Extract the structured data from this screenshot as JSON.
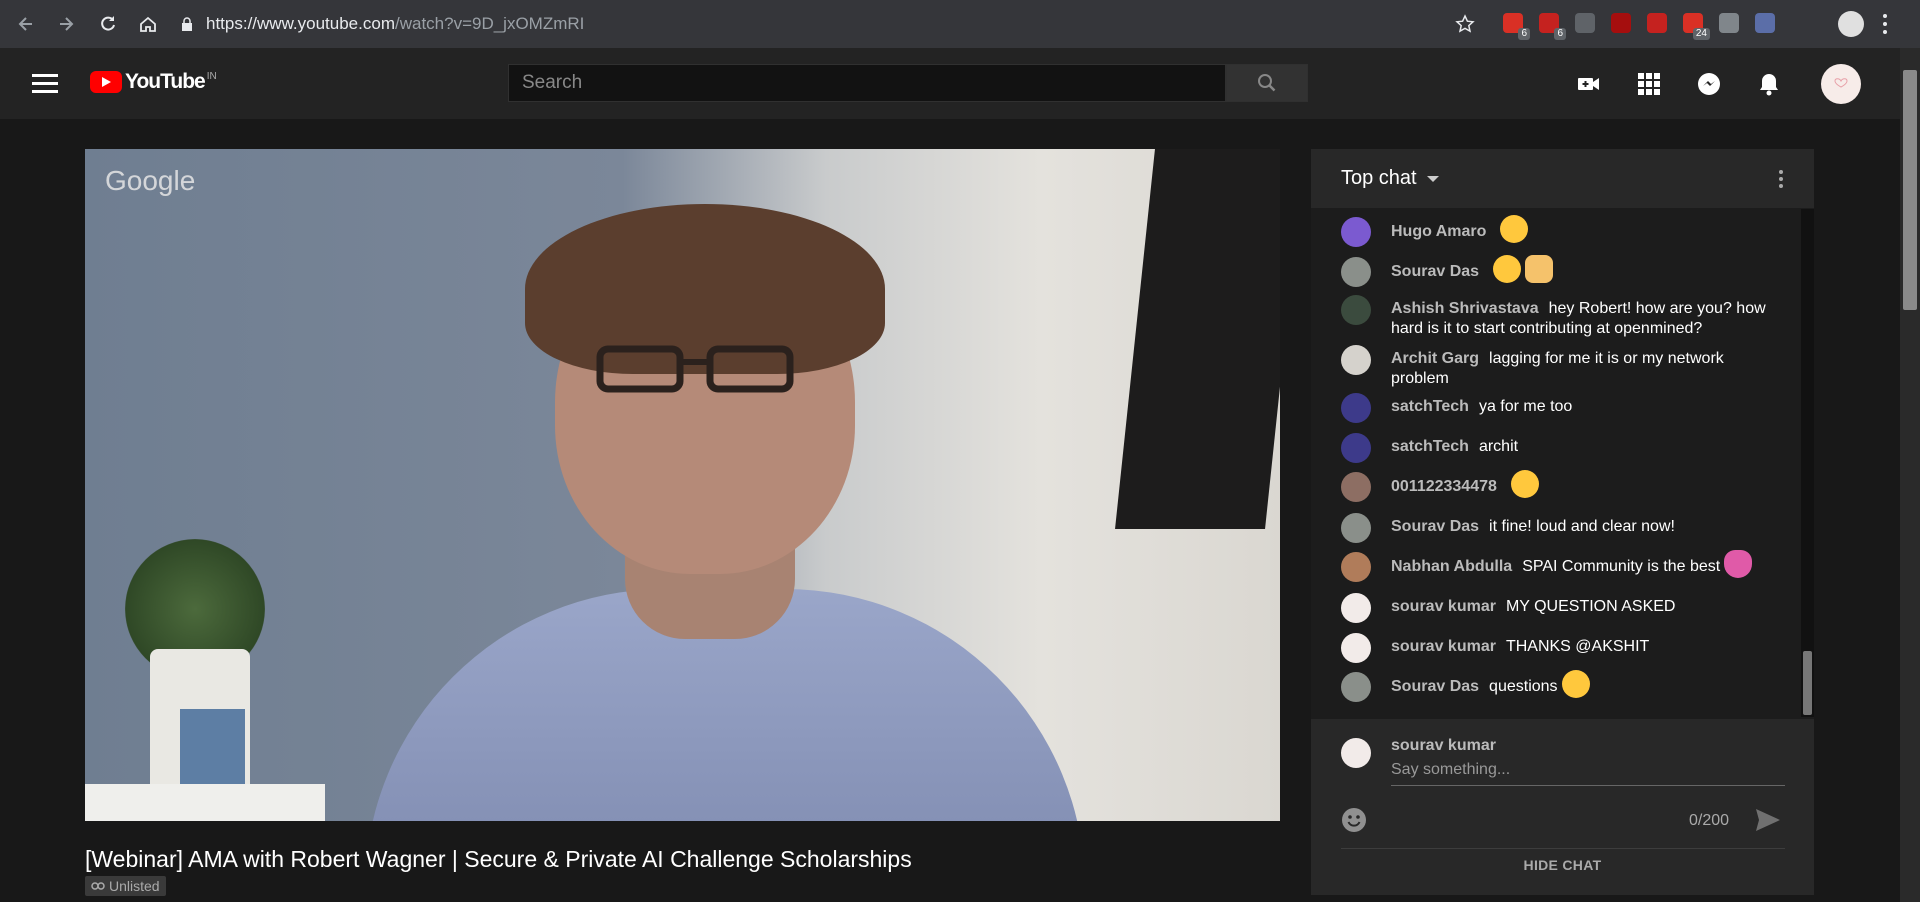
{
  "browser": {
    "url_host": "https://www.youtube.com",
    "url_path": "/watch?v=9D_jxOMZmRI",
    "extensions": [
      {
        "name": "adblock",
        "badge": "6",
        "color": "#d93025"
      },
      {
        "name": "ublock",
        "badge": "6",
        "color": "#c5221f"
      },
      {
        "name": "m-ext",
        "badge": "",
        "color": "#5f6368"
      },
      {
        "name": "pdf-ext",
        "badge": "",
        "color": "#a50e0e"
      },
      {
        "name": "corner-ext",
        "badge": "",
        "color": "#c5221f"
      },
      {
        "name": "record-ext",
        "badge": "24",
        "color": "#d93025"
      },
      {
        "name": "hex-ext",
        "badge": "",
        "color": "#80868b"
      },
      {
        "name": "pen-ext",
        "badge": "",
        "color": "#5b6ea8"
      }
    ]
  },
  "masthead": {
    "logo_text": "YouTube",
    "country_code": "IN",
    "search_placeholder": "Search"
  },
  "video": {
    "watermark": "Google",
    "title": "[Webinar] AMA with Robert Wagner | Secure & Private AI Challenge Scholarships",
    "visibility": "Unlisted"
  },
  "chat": {
    "header": "Top chat",
    "messages": [
      {
        "author": "Hugo Amaro",
        "text": "",
        "emoji": [
          "grin"
        ],
        "avatar_color": "#7b5ad0"
      },
      {
        "author": "Sourav Das",
        "text": "",
        "emoji": [
          "blush",
          "victory"
        ],
        "avatar_color": "#8a8f8a"
      },
      {
        "author": "Ashish Shrivastava",
        "text": "hey Robert! how are you? how hard is it to start contributing at openmined?",
        "emoji": [],
        "avatar_color": "#3b4b3e"
      },
      {
        "author": "Archit Garg",
        "text": "lagging for me it is or my network problem",
        "emoji": [],
        "avatar_color": "#d5d2cc"
      },
      {
        "author": "satchTech",
        "text": "ya for me too",
        "emoji": [],
        "avatar_color": "#3d3a8a"
      },
      {
        "author": "satchTech",
        "text": "archit",
        "emoji": [],
        "avatar_color": "#3d3a8a"
      },
      {
        "author": "001122334478",
        "text": "",
        "emoji": [
          "no-mouth"
        ],
        "avatar_color": "#8d6e63"
      },
      {
        "author": "Sourav Das",
        "text": "it fine! loud and clear now!",
        "emoji": [],
        "avatar_color": "#8a8f8a"
      },
      {
        "author": "Nabhan Abdulla",
        "text": "SPAI Community is the best",
        "emoji": [
          "heart"
        ],
        "avatar_color": "#b07c5a"
      },
      {
        "author": "sourav kumar",
        "text": "MY QUESTION ASKED",
        "emoji": [],
        "avatar_color": "#f2ebe9"
      },
      {
        "author": "sourav kumar",
        "text": "THANKS @AKSHIT",
        "emoji": [],
        "avatar_color": "#f2ebe9"
      },
      {
        "author": "Sourav Das",
        "text": "questions",
        "emoji": [
          "wink"
        ],
        "avatar_color": "#8a8f8a"
      }
    ],
    "input": {
      "user": "sourav kumar",
      "placeholder": "Say something...",
      "counter": "0/200"
    },
    "hide_label": "HIDE CHAT"
  }
}
